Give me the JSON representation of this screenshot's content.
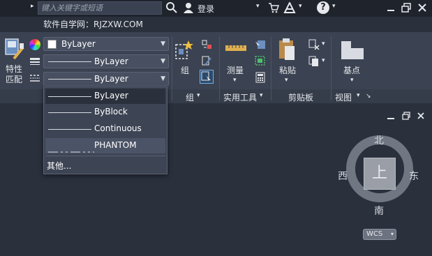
{
  "titlebar": {
    "search_placeholder": "键入关键字或短语",
    "login_label": "登录",
    "help_glyph": "?"
  },
  "watermark": "软件自学网：RJZXW.COM",
  "properties": {
    "match_label_line1": "特性",
    "match_label_line2": "匹配",
    "color_combo_value": "ByLayer",
    "lineweight_combo_value": "ByLayer",
    "linetype_combo_value": "ByLayer"
  },
  "linetype_dropdown": {
    "items": [
      {
        "label": "ByLayer"
      },
      {
        "label": "ByBlock"
      },
      {
        "label": "Continuous"
      },
      {
        "label": "PHANTOM"
      }
    ],
    "other_label": "其他..."
  },
  "ribbon": {
    "group_label": "组",
    "group_panel_label": "组",
    "measure_label": "测量",
    "utilities_panel_label": "实用工具",
    "paste_label": "粘贴",
    "clipboard_panel_label": "剪贴板",
    "base_label": "基点",
    "view_panel_label": "视图"
  },
  "viewcube": {
    "north": "北",
    "south": "南",
    "east": "东",
    "west": "西",
    "top_face": "上",
    "wcs_label": "WCS"
  },
  "colors": {
    "background": "#2a303c",
    "ribbon": "#3b4251",
    "titlebar": "#1e232c"
  }
}
